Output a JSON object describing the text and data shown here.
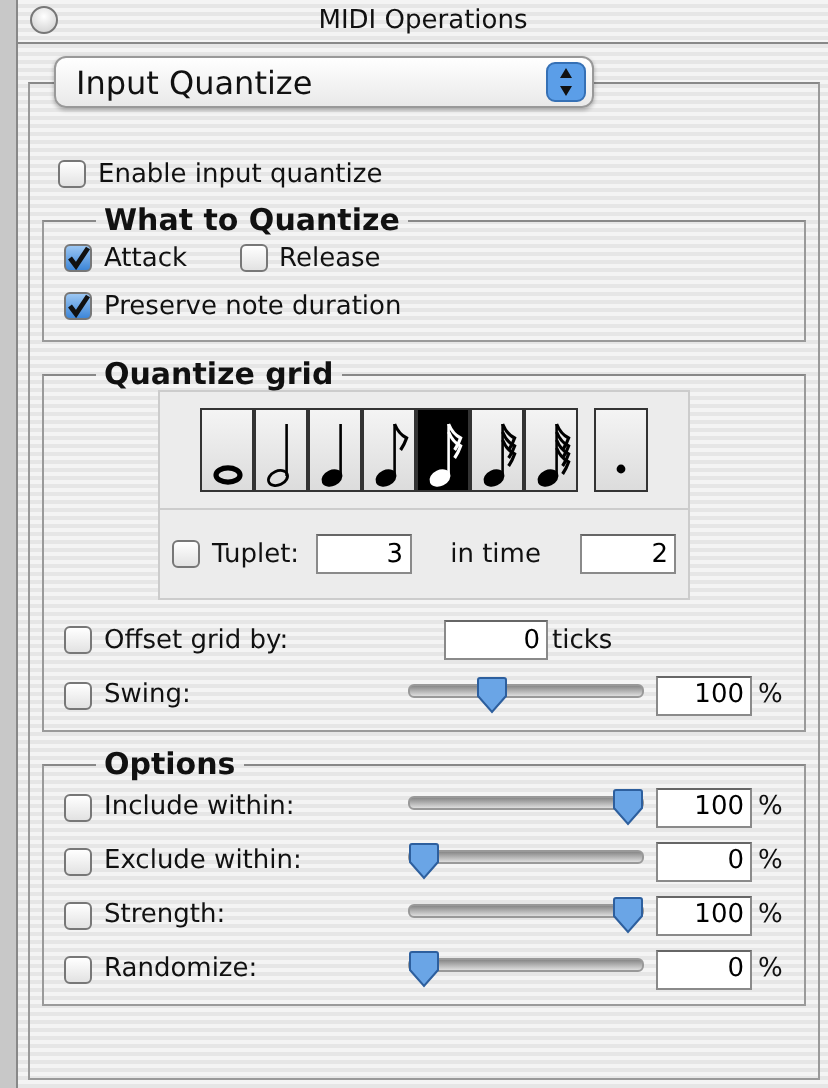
{
  "window": {
    "title": "MIDI Operations"
  },
  "mode_popup": {
    "value": "Input Quantize"
  },
  "enable": {
    "label": "Enable input quantize",
    "checked": false
  },
  "what_to_quantize": {
    "title": "What to Quantize",
    "options": [
      {
        "label": "Attack",
        "checked": true
      },
      {
        "label": "Release",
        "checked": false
      },
      {
        "label": "Preserve note duration",
        "checked": true
      }
    ]
  },
  "quantize_grid": {
    "title": "Quantize grid",
    "notes": [
      {
        "kind": "whole",
        "selected": false
      },
      {
        "kind": "half",
        "selected": false
      },
      {
        "kind": "quarter",
        "selected": false
      },
      {
        "kind": "eighth",
        "selected": false
      },
      {
        "kind": "sixteenth",
        "selected": true
      },
      {
        "kind": "thirtysecond",
        "selected": false
      },
      {
        "kind": "sixtyfourth",
        "selected": false
      }
    ],
    "dotted": {
      "selected": false
    },
    "tuplet": {
      "label": "Tuplet:",
      "checked": false,
      "value": "3",
      "in_time_label": "in time",
      "in_time_value": "2"
    },
    "offset": {
      "label": "Offset grid by:",
      "checked": false,
      "value": "0",
      "unit": "ticks"
    },
    "swing": {
      "label": "Swing:",
      "checked": false,
      "level": 0.33,
      "value": "100",
      "unit": "%"
    }
  },
  "options": {
    "title": "Options",
    "rows": [
      {
        "label": "Include within:",
        "checked": false,
        "level": 1,
        "value": "100",
        "unit": "%"
      },
      {
        "label": "Exclude within:",
        "checked": false,
        "level": 0,
        "value": "0",
        "unit": "%"
      },
      {
        "label": "Strength:",
        "checked": false,
        "level": 1,
        "value": "100",
        "unit": "%"
      },
      {
        "label": "Randomize:",
        "checked": false,
        "level": 0,
        "value": "0",
        "unit": "%"
      }
    ]
  }
}
